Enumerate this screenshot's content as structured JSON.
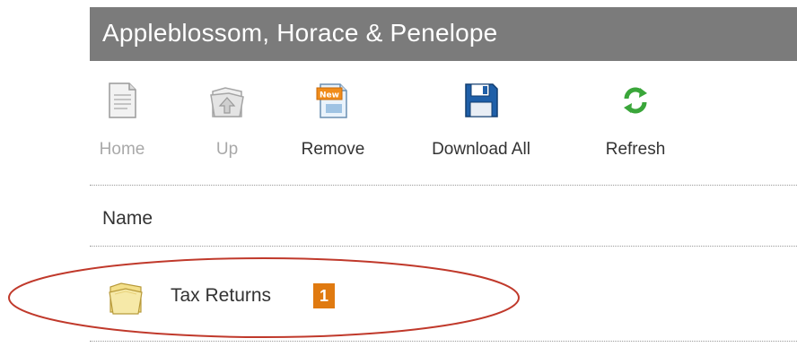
{
  "header": {
    "title": "Appleblossom, Horace & Penelope"
  },
  "toolbar": {
    "buttons": [
      {
        "label": "Home",
        "icon": "document-icon",
        "enabled": false
      },
      {
        "label": "Up",
        "icon": "folder-up-icon",
        "enabled": false
      },
      {
        "label": "Remove",
        "icon": "new-document-icon",
        "enabled": true
      },
      {
        "label": "Download All",
        "icon": "floppy-disk-icon",
        "enabled": true
      },
      {
        "label": "Refresh",
        "icon": "refresh-arrows-icon",
        "enabled": true
      }
    ]
  },
  "list": {
    "column_header": "Name",
    "rows": [
      {
        "name": "Tax Returns",
        "icon": "folder-icon",
        "badge": "1"
      }
    ]
  },
  "colors": {
    "title_bar": "#7b7b7b",
    "badge": "#e07a10",
    "highlight_ellipse": "#c0392b",
    "disabled_text": "#a9a9a9"
  }
}
